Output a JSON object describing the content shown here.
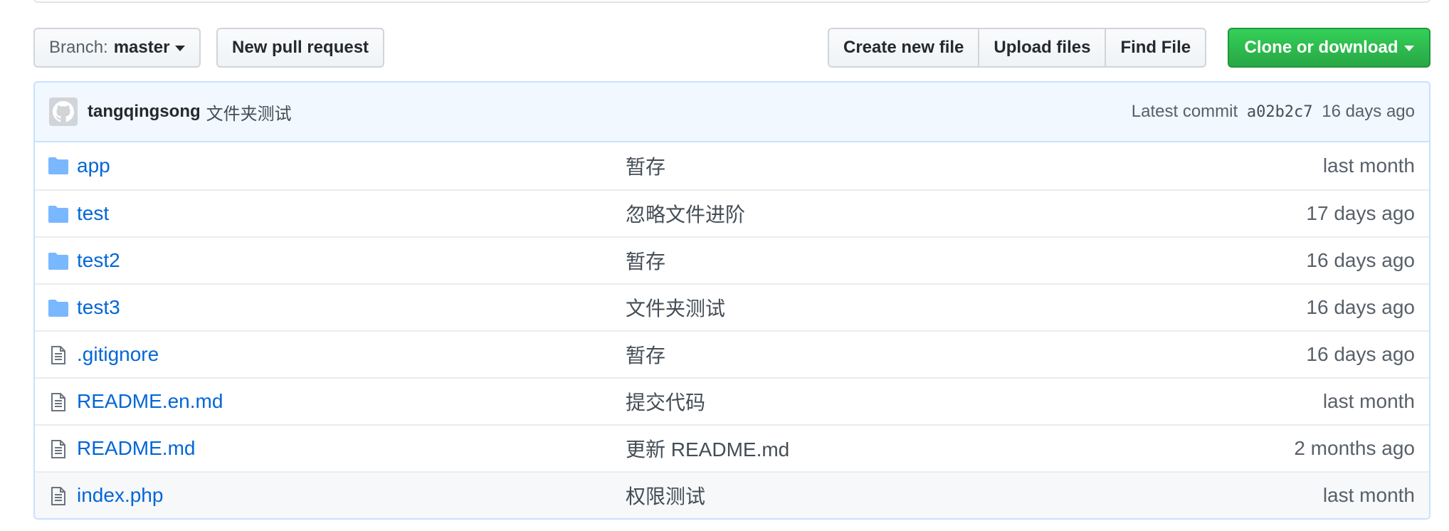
{
  "toolbar": {
    "branch_prefix": "Branch:",
    "branch_name": "master",
    "new_pull_request": "New pull request",
    "create_new_file": "Create new file",
    "upload_files": "Upload files",
    "find_file": "Find File",
    "clone_or_download": "Clone or download"
  },
  "commit": {
    "author": "tangqingsong",
    "message": "文件夹测试",
    "latest_label": "Latest commit",
    "sha": "a02b2c7",
    "age": "16 days ago"
  },
  "files": [
    {
      "type": "folder",
      "name": "app",
      "message": "暂存",
      "age": "last month"
    },
    {
      "type": "folder",
      "name": "test",
      "message": "忽略文件进阶",
      "age": "17 days ago"
    },
    {
      "type": "folder",
      "name": "test2",
      "message": "暂存",
      "age": "16 days ago"
    },
    {
      "type": "folder",
      "name": "test3",
      "message": "文件夹测试",
      "age": "16 days ago"
    },
    {
      "type": "file",
      "name": ".gitignore",
      "message": "暂存",
      "age": "16 days ago"
    },
    {
      "type": "file",
      "name": "README.en.md",
      "message": "提交代码",
      "age": "last month"
    },
    {
      "type": "file",
      "name": "README.md",
      "message": "更新 README.md",
      "age": "2 months ago"
    },
    {
      "type": "file",
      "name": "index.php",
      "message": "权限测试",
      "age": "last month"
    }
  ],
  "colors": {
    "link": "#0366d6",
    "green_button": "#2cbe4e",
    "commit_bar": "#f1f8ff",
    "folder_icon": "#79b8ff"
  }
}
